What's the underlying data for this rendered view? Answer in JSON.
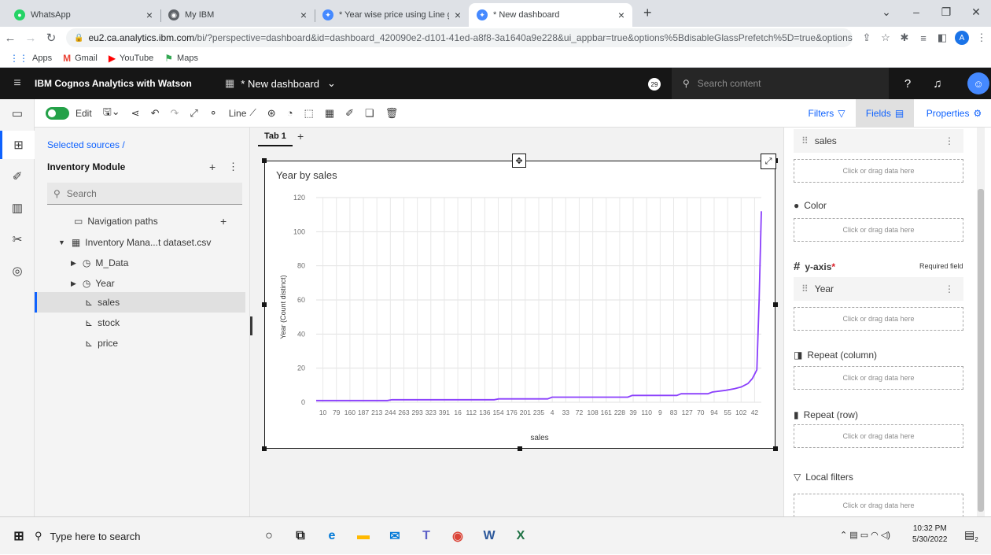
{
  "browser": {
    "tabs": [
      {
        "title": "WhatsApp",
        "icon": "whatsapp-icon",
        "color": "#25d366"
      },
      {
        "title": "My IBM",
        "icon": "ibm-icon",
        "color": "#5f6368"
      },
      {
        "title": "* Year wise price using Line grapl",
        "icon": "cognos-icon",
        "color": "#4589ff"
      },
      {
        "title": "* New dashboard",
        "icon": "cognos-icon",
        "color": "#4589ff"
      }
    ],
    "url_host": "eu2.ca.analytics.ibm.com",
    "url_path": "/bi/?perspective=dashboard&id=dashboard_420090e2-d101-41ed-a8f8-3a1640a9e228&ui_appbar=true&options%5BdisableGlassPrefetch%5D=true&options%...",
    "avatar_letter": "A",
    "bookmarks": [
      "Apps",
      "Gmail",
      "YouTube",
      "Maps"
    ]
  },
  "app": {
    "brand": "IBM Cognos Analytics with Watson",
    "dashboard_name": "* New dashboard",
    "notifications": "29",
    "search_placeholder": "Search content"
  },
  "toolbar": {
    "edit_label": "Edit",
    "viz_label": "Line",
    "filters_label": "Filters",
    "fields_label": "Fields",
    "properties_label": "Properties"
  },
  "sources": {
    "breadcrumb": "Selected sources  /",
    "module": "Inventory Module",
    "search_placeholder": "Search",
    "items": [
      {
        "label": "Navigation paths",
        "icon": "folder-icon"
      },
      {
        "label": "Inventory Mana...t dataset.csv",
        "icon": "table-icon"
      },
      {
        "label": "M_Data",
        "icon": "clock-icon"
      },
      {
        "label": "Year",
        "icon": "clock-icon"
      },
      {
        "label": "sales",
        "icon": "measure-icon"
      },
      {
        "label": "stock",
        "icon": "measure-icon"
      },
      {
        "label": "price",
        "icon": "measure-icon"
      }
    ]
  },
  "canvas": {
    "tab_label": "Tab 1"
  },
  "chart_data": {
    "type": "line",
    "title": "Year by sales",
    "xlabel": "sales",
    "ylabel": "Year (Count distinct)",
    "ylim": [
      0,
      120
    ],
    "yticks": [
      0,
      20,
      40,
      60,
      80,
      100,
      120
    ],
    "x_tick_labels": [
      "10",
      "79",
      "160",
      "187",
      "213",
      "244",
      "263",
      "293",
      "323",
      "391",
      "16",
      "112",
      "136",
      "154",
      "176",
      "201",
      "235",
      "4",
      "33",
      "72",
      "108",
      "161",
      "228",
      "39",
      "110",
      "9",
      "83",
      "127",
      "70",
      "94",
      "55",
      "102",
      "42"
    ],
    "series": [
      {
        "color": "#8a3ffc",
        "values": [
          [
            0,
            1
          ],
          [
            0.16,
            1
          ],
          [
            0.17,
            1.5
          ],
          [
            0.4,
            1.5
          ],
          [
            0.41,
            2
          ],
          [
            0.52,
            2
          ],
          [
            0.53,
            3
          ],
          [
            0.7,
            3
          ],
          [
            0.71,
            4
          ],
          [
            0.81,
            4
          ],
          [
            0.82,
            5
          ],
          [
            0.88,
            5
          ],
          [
            0.89,
            6
          ],
          [
            0.92,
            7
          ],
          [
            0.94,
            8
          ],
          [
            0.955,
            9
          ],
          [
            0.97,
            11
          ],
          [
            0.98,
            14
          ],
          [
            0.99,
            19
          ],
          [
            0.995,
            60
          ],
          [
            1,
            112
          ]
        ]
      }
    ]
  },
  "fields": {
    "first_field": "sales",
    "drop_hint": "Click or drag data here",
    "color_label": "Color",
    "yaxis_label": "y-axis",
    "required_label": "Required field",
    "yaxis_field": "Year",
    "repeat_col_label": "Repeat (column)",
    "repeat_row_label": "Repeat (row)",
    "local_filters_label": "Local filters"
  },
  "taskbar": {
    "search_placeholder": "Type here to search",
    "time": "10:32 PM",
    "date": "5/30/2022",
    "notif_count": "2"
  }
}
